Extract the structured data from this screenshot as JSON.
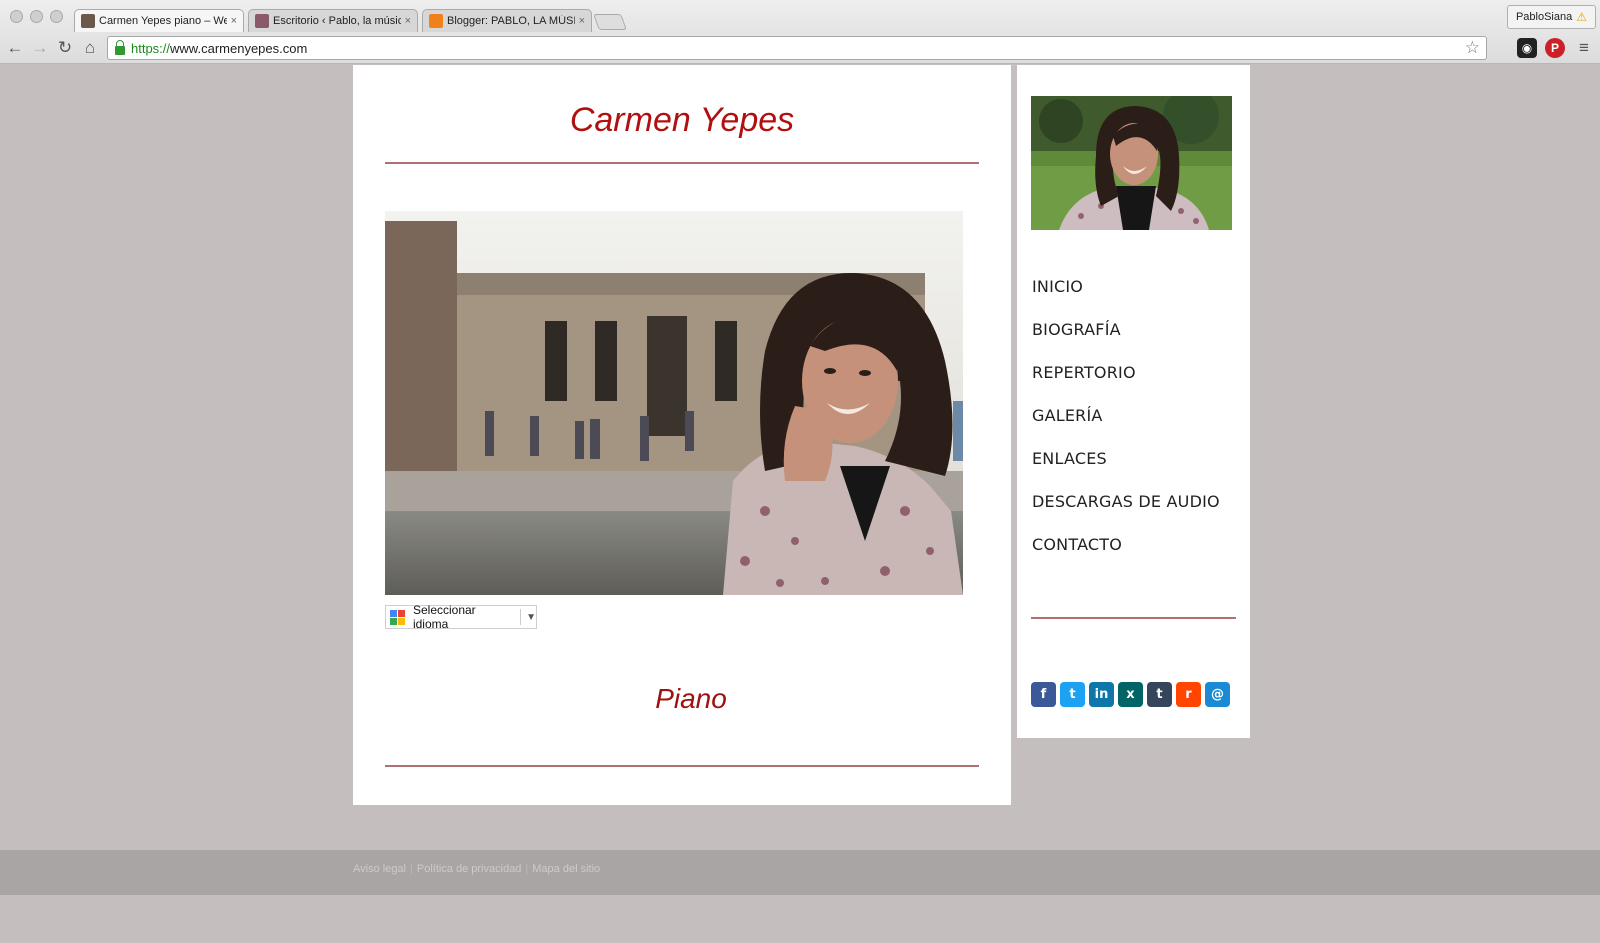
{
  "browser": {
    "tabs": [
      {
        "title": "Carmen Yepes piano – Wel",
        "favicon_color": "#6b5a4a",
        "active": true
      },
      {
        "title": "Escritorio ‹ Pablo, la músic",
        "favicon_color": "#8a5a6a",
        "active": false
      },
      {
        "title": "Blogger: PABLO, LA MÚSIC",
        "favicon_color": "#f0801a",
        "active": false
      }
    ],
    "tab_close": "×",
    "profile_name": "PabloSiana",
    "profile_warning": "⚠",
    "url_scheme": "https://",
    "url_rest": "www.carmenyepes.com",
    "icons": {
      "back": "←",
      "forward": "→",
      "reload": "↻",
      "home": "⌂",
      "bookmark": "☆",
      "menu": "≡",
      "ext_owl": "◉",
      "ext_pinterest": "P"
    }
  },
  "site": {
    "title": "Carmen Yepes",
    "language_selector": "Seleccionar idioma",
    "language_arrow": "▼",
    "section_title": "Piano",
    "accent_color": "#b01010"
  },
  "menu": {
    "items": [
      {
        "label": "INICIO"
      },
      {
        "label": "BIOGRAFÍA"
      },
      {
        "label": "REPERTORIO"
      },
      {
        "label": "GALERÍA"
      },
      {
        "label": "ENLACES"
      },
      {
        "label": "DESCARGAS DE AUDIO"
      },
      {
        "label": "CONTACTO"
      }
    ]
  },
  "social": [
    {
      "name": "facebook",
      "glyph": "f",
      "color": "#3b5998"
    },
    {
      "name": "twitter",
      "glyph": "t",
      "color": "#1da1f2"
    },
    {
      "name": "linkedin",
      "glyph": "in",
      "color": "#0e76a8"
    },
    {
      "name": "xing",
      "glyph": "x",
      "color": "#026466"
    },
    {
      "name": "tumblr",
      "glyph": "t",
      "color": "#35465c"
    },
    {
      "name": "reddit",
      "glyph": "r",
      "color": "#ff4500"
    },
    {
      "name": "email",
      "glyph": "@",
      "color": "#1a8ad4"
    }
  ],
  "footer": {
    "links": [
      {
        "label": "Aviso legal"
      },
      {
        "label": "Política de privacidad"
      },
      {
        "label": "Mapa del sitio"
      }
    ],
    "separator": "|"
  }
}
